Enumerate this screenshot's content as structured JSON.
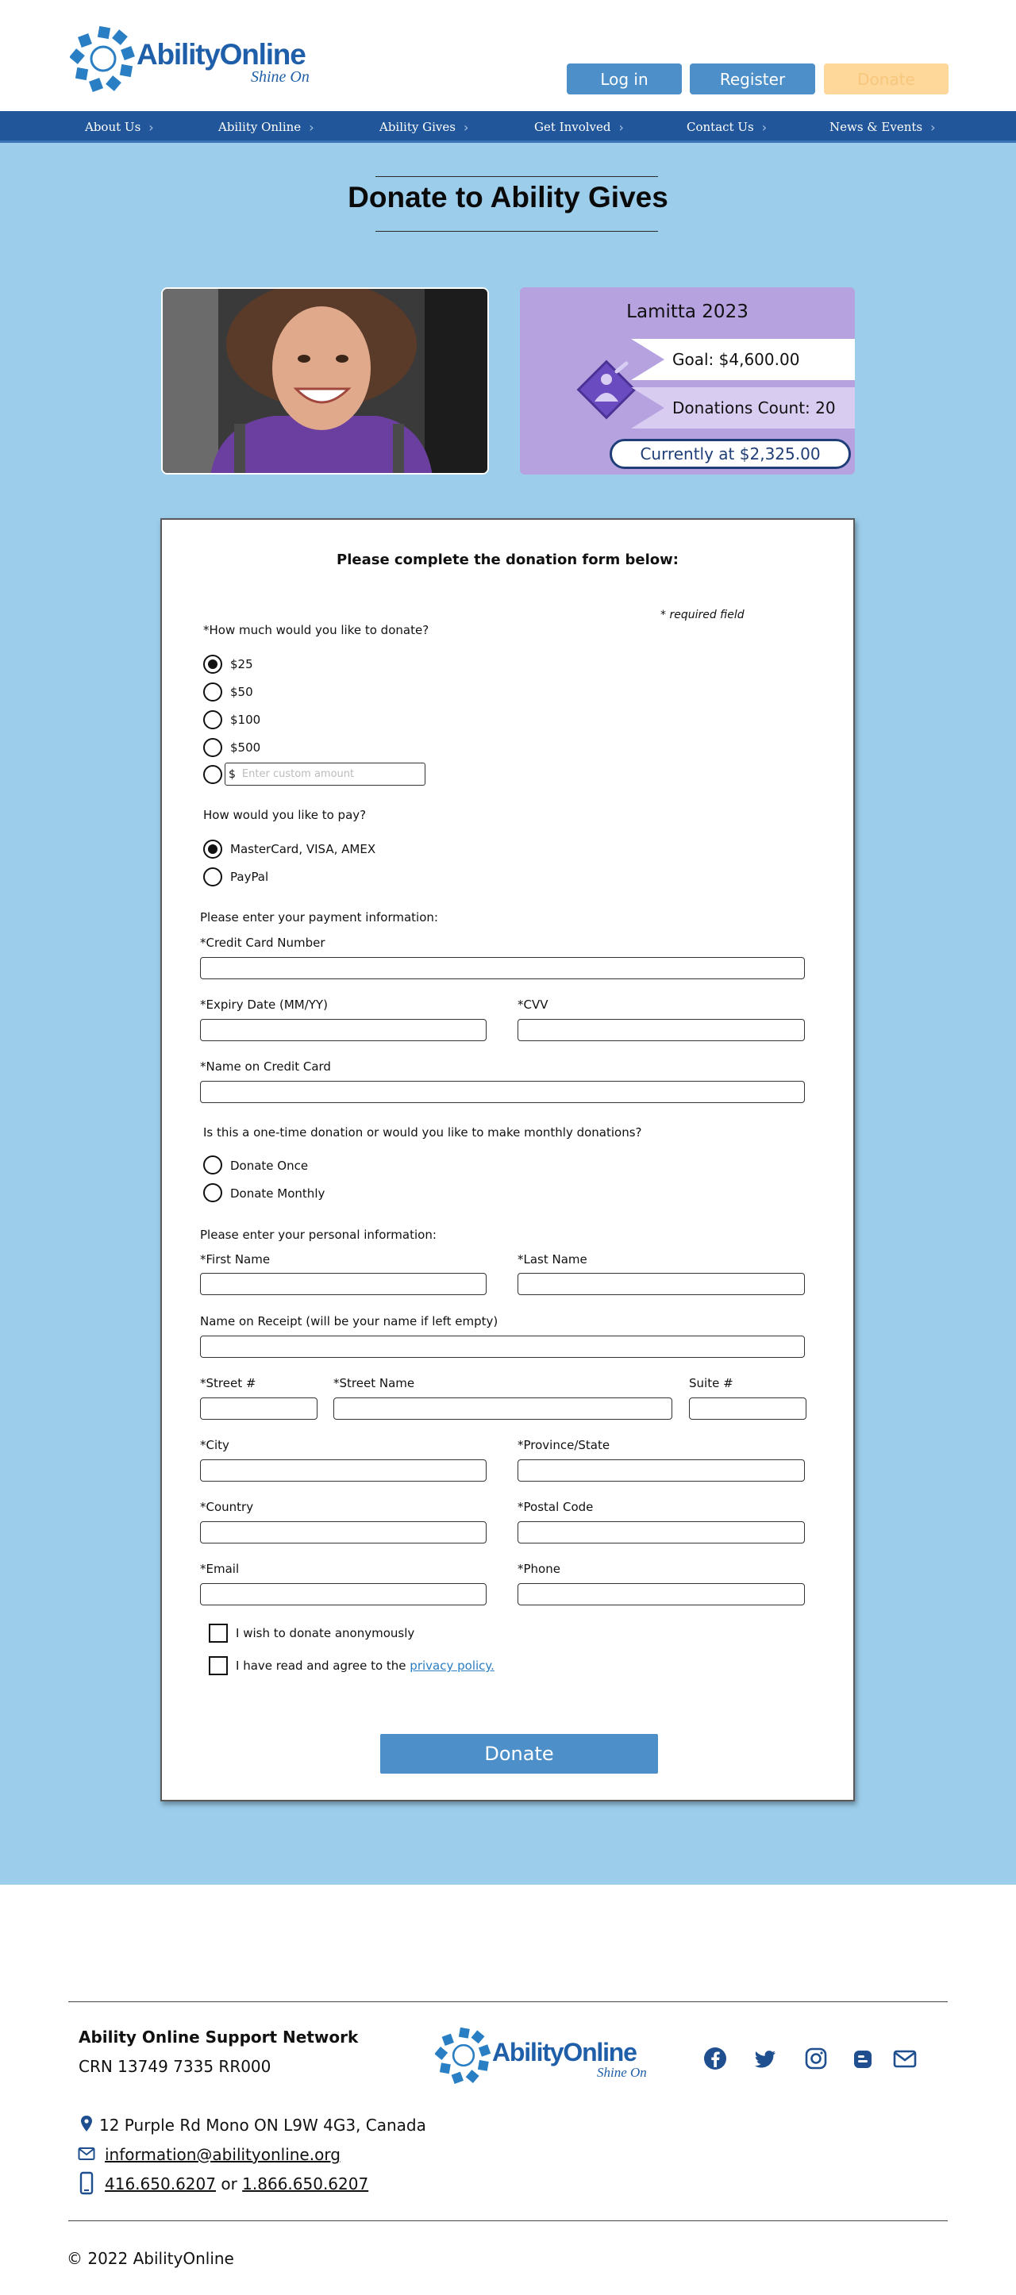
{
  "header": {
    "logo_word": "AbilityOnline",
    "logo_tag": "Shine On",
    "login_label": "Log in",
    "register_label": "Register",
    "donate_label": "Donate"
  },
  "nav": {
    "items": [
      "About Us",
      "Ability Online",
      "Ability Gives",
      "Get Involved",
      "Contact Us",
      "News & Events"
    ]
  },
  "page": {
    "title": "Donate to Ability Gives"
  },
  "campaign": {
    "name": "Lamitta 2023",
    "goal": "Goal: $4,600.00",
    "count": "Donations Count: 20",
    "current": "Currently at $2,325.00",
    "photo_alt": "Smiling girl in a purple shirt"
  },
  "form": {
    "heading": "Please complete the donation form below:",
    "required_note": "* required field",
    "amount_question": "*How much would you like to donate?",
    "amounts": [
      "$25",
      "$50",
      "$100",
      "$500"
    ],
    "selected_amount": "$25",
    "custom_prefix": "$",
    "custom_placeholder": "Enter custom amount",
    "pay_question": "How would you like to pay?",
    "pay_options": [
      "MasterCard, VISA, AMEX",
      "PayPal"
    ],
    "selected_pay": "MasterCard, VISA, AMEX",
    "payment_heading": "Please enter your payment information:",
    "card_number_label": "*Credit Card Number",
    "expiry_label": "*Expiry Date (MM/YY)",
    "cvv_label": "*CVV",
    "name_on_card_label": "*Name on Credit Card",
    "frequency_question": "Is this a one-time donation or would you like to make monthly donations?",
    "frequency_options": [
      "Donate Once",
      "Donate Monthly"
    ],
    "personal_heading": "Please enter your personal information:",
    "first_name_label": "*First Name",
    "last_name_label": "*Last Name",
    "receipt_name_label": "Name on Receipt (will be your name if left empty)",
    "street_no_label": "*Street #",
    "street_name_label": "*Street Name",
    "suite_label": "Suite #",
    "city_label": "*City",
    "province_label": "*Province/State",
    "country_label": "*Country",
    "postal_label": "*Postal Code",
    "email_label": "*Email",
    "phone_label": "*Phone",
    "anonymous_label": "I wish to donate anonymously",
    "agree_prefix": "I have read and agree to the ",
    "privacy_link": "privacy policy.",
    "submit_label": "Donate"
  },
  "footer": {
    "org": "Ability Online Support Network",
    "crn": "CRN 13749 7335 RR000",
    "address": "12 Purple Rd Mono ON L9W 4G3, Canada",
    "email": "information@abilityonline.org",
    "phone_1": "416.650.6207",
    "phone_or": " or ",
    "phone_2": "1.866.650.6207",
    "copyright": "© 2022 AbilityOnline",
    "social_icons": [
      "facebook-icon",
      "twitter-icon",
      "instagram-icon",
      "blogger-icon",
      "mail-icon"
    ]
  },
  "colors": {
    "primary_blue": "#4d8fc8",
    "nav_blue": "#21579a",
    "page_bg": "#9ccdeb",
    "campaign_purple": "#b7a2e0",
    "donate_disabled": "#fed79a"
  }
}
